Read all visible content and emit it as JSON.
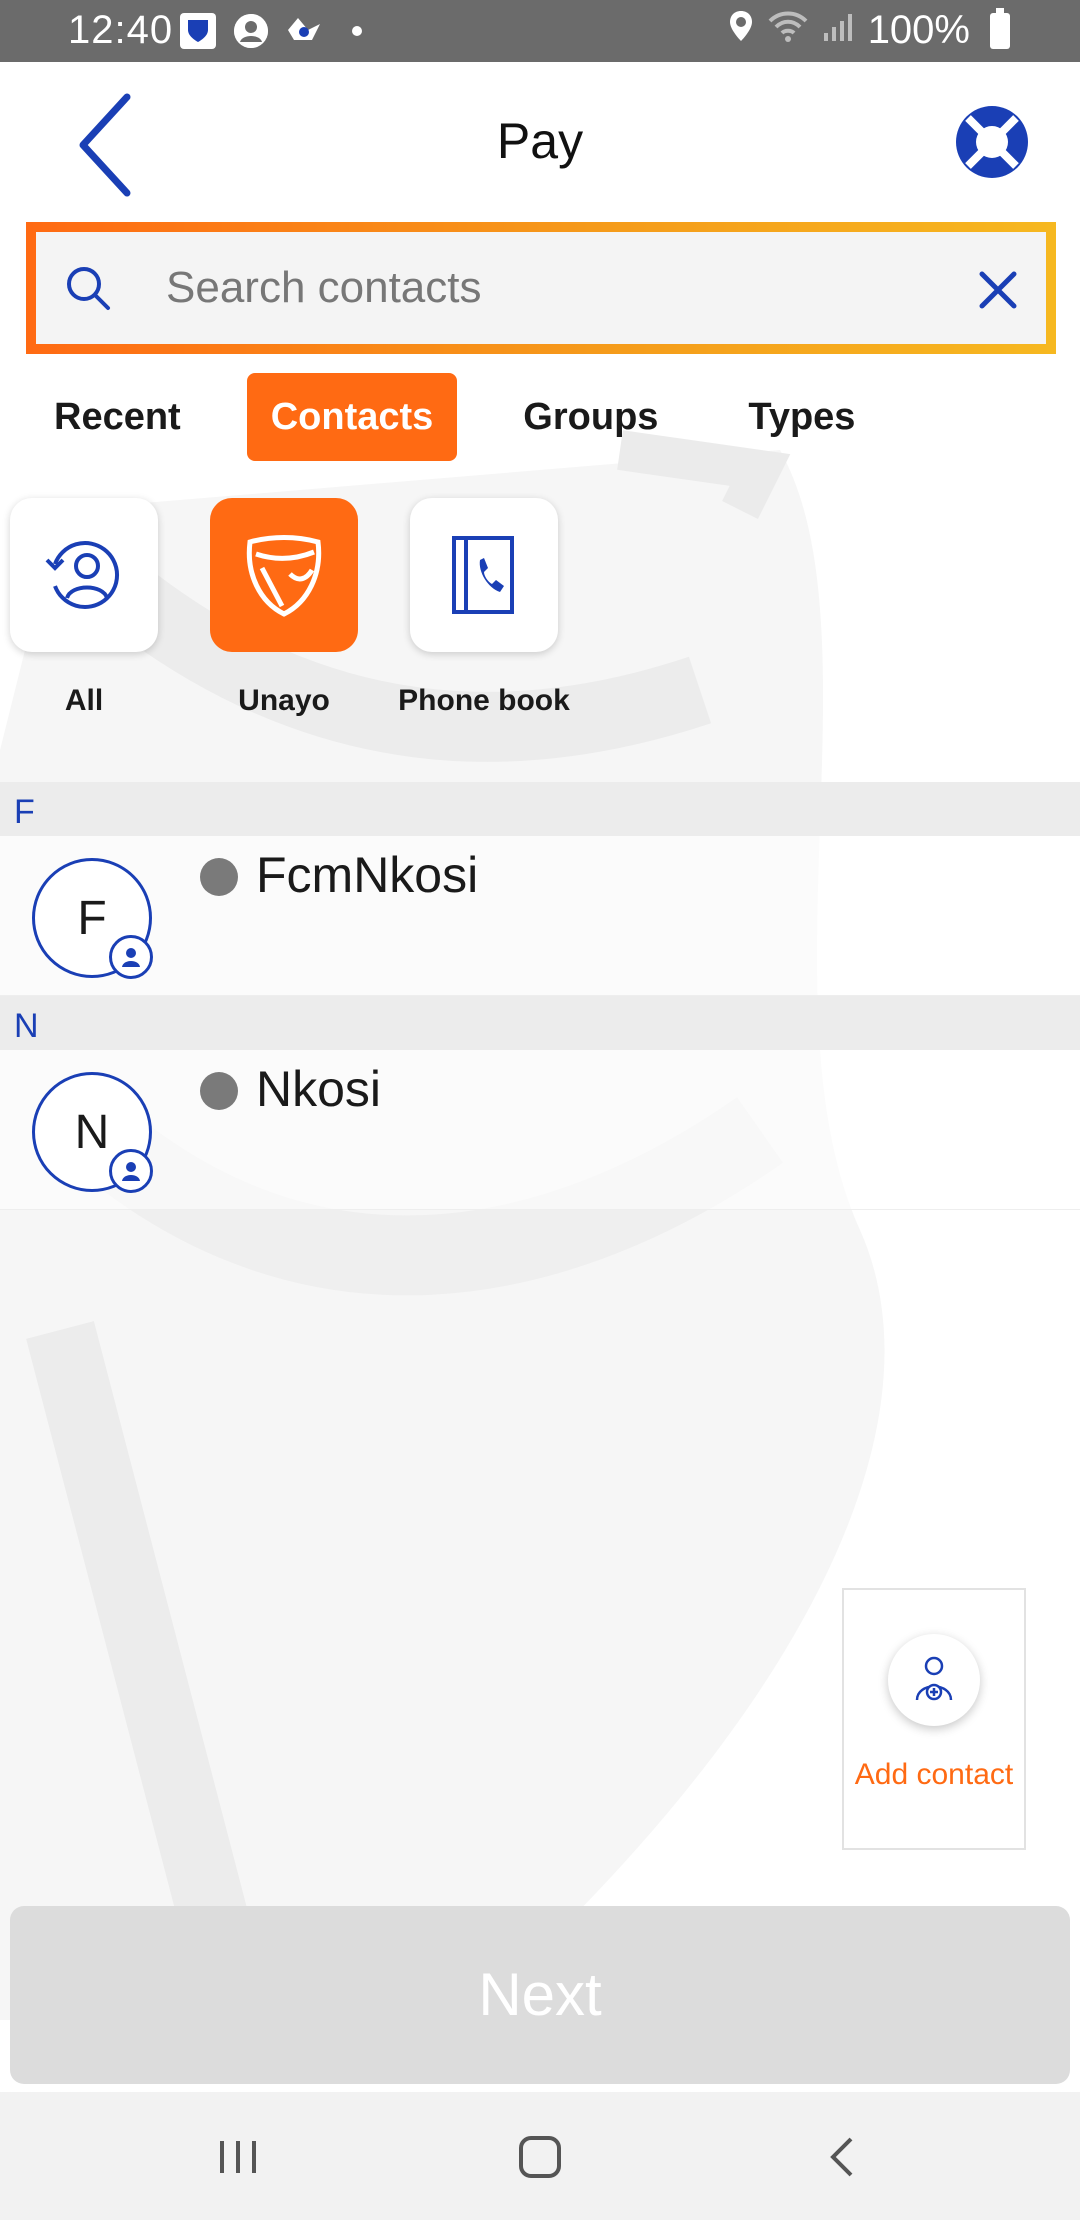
{
  "status_bar": {
    "time": "12:40",
    "battery": "100%",
    "icons": [
      "bank-app-icon",
      "account-icon",
      "game-icon",
      "dot-icon",
      "location-icon",
      "wifi-icon",
      "signal-icon",
      "battery-icon"
    ]
  },
  "header": {
    "title": "Pay",
    "back_icon": "chevron-left-icon",
    "help_icon": "lifebuoy-icon"
  },
  "search": {
    "placeholder": "Search contacts",
    "value": ""
  },
  "tabs": [
    {
      "label": "Recent",
      "active": false
    },
    {
      "label": "Contacts",
      "active": true
    },
    {
      "label": "Groups",
      "active": false
    },
    {
      "label": "Types",
      "active": false
    }
  ],
  "sources": [
    {
      "label": "All",
      "icon": "contacts-refresh-icon",
      "active": false
    },
    {
      "label": "Unayo",
      "icon": "unayo-shield-icon",
      "active": true
    },
    {
      "label": "Phone book",
      "icon": "phone-book-icon",
      "active": false
    }
  ],
  "contact_sections": [
    {
      "letter": "F",
      "contacts": [
        {
          "initial": "F",
          "name": "FcmNkosi"
        }
      ]
    },
    {
      "letter": "N",
      "contacts": [
        {
          "initial": "N",
          "name": "Nkosi"
        }
      ]
    }
  ],
  "add_contact": {
    "label": "Add contact"
  },
  "next_button": {
    "label": "Next",
    "enabled": false
  },
  "colors": {
    "accent": "#ff6a13",
    "brand_blue": "#1a3fb5",
    "disabled": "#dcdcdc"
  }
}
